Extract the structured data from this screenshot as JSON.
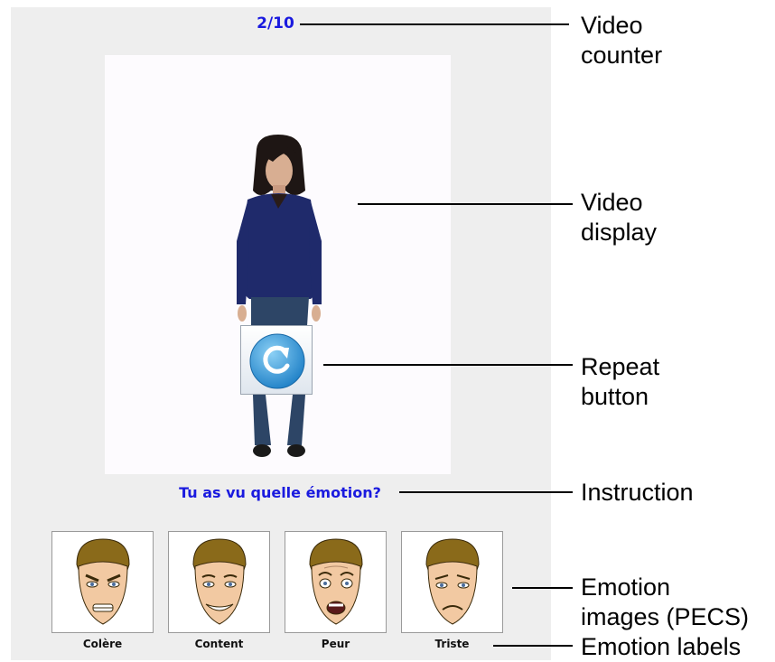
{
  "app": {
    "counter": "2/10",
    "instruction": "Tu as vu quelle émotion?",
    "repeat_button_icon": "repeat-arrow-icon"
  },
  "emotions": [
    {
      "label": "Colère",
      "icon": "angry-face-icon"
    },
    {
      "label": "Content",
      "icon": "happy-face-icon"
    },
    {
      "label": "Peur",
      "icon": "fear-face-icon"
    },
    {
      "label": "Triste",
      "icon": "sad-face-icon"
    }
  ],
  "annotations": {
    "video_counter": "Video\ncounter",
    "video_display": "Video\ndisplay",
    "repeat_button": "Repeat\nbutton",
    "instruction": "Instruction",
    "emotion_images": "Emotion\nimages (PECS)",
    "emotion_labels": "Emotion labels"
  },
  "colors": {
    "accent_blue": "#1a1adf",
    "panel_gray": "#eeeeee"
  }
}
